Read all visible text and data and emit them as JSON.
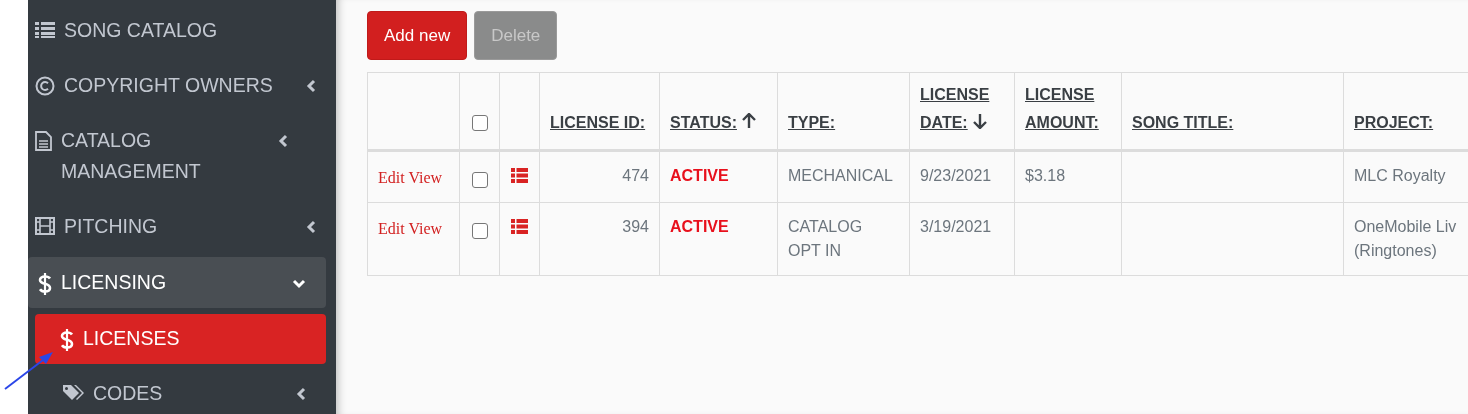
{
  "sidebar": {
    "items": [
      {
        "label": "SONG CATALOG",
        "kind": "list",
        "has_submenu": false,
        "expanded": false,
        "selected": false
      },
      {
        "label": "COPYRIGHT OWNERS",
        "kind": "copyright",
        "has_submenu": true,
        "expanded": false,
        "selected": false
      },
      {
        "label": "CATALOG MANAGEMENT",
        "kind": "file",
        "has_submenu": true,
        "expanded": false,
        "selected": false
      },
      {
        "label": "PITCHING",
        "kind": "film",
        "has_submenu": true,
        "expanded": false,
        "selected": false
      },
      {
        "label": "LICENSING",
        "kind": "dollar",
        "has_submenu": true,
        "expanded": true,
        "selected": false,
        "children": [
          {
            "label": "LICENSES",
            "kind": "dollar",
            "has_submenu": false,
            "expanded": false,
            "selected": true
          },
          {
            "label": "CODES",
            "kind": "tag",
            "has_submenu": true,
            "expanded": false,
            "selected": false
          }
        ]
      }
    ]
  },
  "toolbar": {
    "buttons": [
      {
        "label": "Add new",
        "disabled": false
      },
      {
        "label": "Delete",
        "disabled": true
      }
    ]
  },
  "table": {
    "select_all": {
      "checked": false
    },
    "columns": [
      {
        "label": "LICENSE ID:",
        "sorted": false
      },
      {
        "label": "STATUS:",
        "sorted": true,
        "descending": false
      },
      {
        "label": "TYPE:",
        "sorted": false
      },
      {
        "label": "LICENSE DATE:",
        "sorted": true,
        "descending": true
      },
      {
        "label": "LICENSE AMOUNT:",
        "sorted": false
      },
      {
        "label": "SONG TITLE:",
        "sorted": false
      },
      {
        "label": "PROJECT:",
        "sorted": false
      }
    ],
    "rows": [
      {
        "edit": "Edit",
        "view": "View",
        "checked": false,
        "cells": [
          "474",
          "ACTIVE",
          "MECHANICAL",
          "9/23/2021",
          "$3.18",
          "",
          "MLC Royalty"
        ]
      },
      {
        "edit": "Edit",
        "view": "View",
        "checked": false,
        "cells": [
          "394",
          "ACTIVE",
          "CATALOG OPT IN",
          "3/19/2021",
          "",
          "",
          "OneMobile Liv (Ringtones)"
        ]
      }
    ]
  }
}
